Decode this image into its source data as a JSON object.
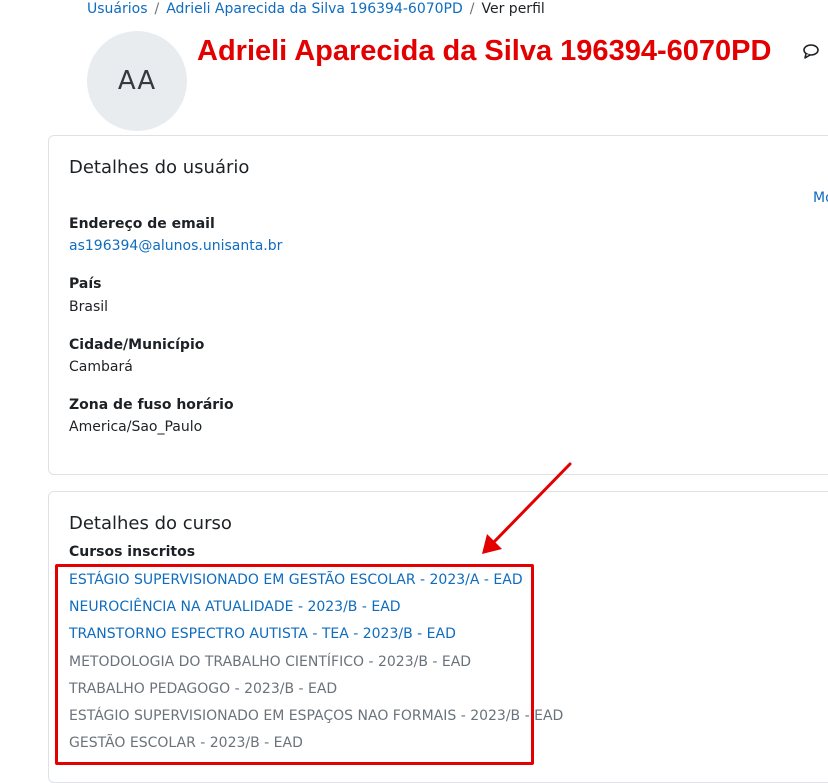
{
  "breadcrumb": {
    "items": [
      {
        "label": "Usuários"
      },
      {
        "label": "Adrieli Aparecida da Silva 196394-6070PD"
      },
      {
        "label": "Ver perfil"
      }
    ],
    "separator": "/"
  },
  "profile": {
    "avatar_initials": "AA",
    "name": "Adrieli Aparecida da Silva 196394-6070PD",
    "message_icon": "speech-bubble-icon"
  },
  "user_details": {
    "title": "Detalhes do usuário",
    "more_link": "Mo",
    "email": {
      "label": "Endereço de email",
      "value": "as196394@alunos.unisanta.br"
    },
    "country": {
      "label": "País",
      "value": "Brasil"
    },
    "city": {
      "label": "Cidade/Município",
      "value": "Cambará"
    },
    "timezone": {
      "label": "Zona de fuso horário",
      "value": "America/Sao_Paulo"
    }
  },
  "course_details": {
    "title": "Detalhes do curso",
    "enrolled_label": "Cursos inscritos",
    "courses": [
      {
        "name": "ESTÁGIO SUPERVISIONADO EM GESTÃO ESCOLAR - 2023/A - EAD",
        "status": "active"
      },
      {
        "name": "NEUROCIÊNCIA NA ATUALIDADE - 2023/B - EAD",
        "status": "active"
      },
      {
        "name": "TRANSTORNO ESPECTRO AUTISTA - TEA - 2023/B - EAD",
        "status": "active"
      },
      {
        "name": "METODOLOGIA DO TRABALHO CIENTÍFICO - 2023/B - EAD",
        "status": "inactive"
      },
      {
        "name": "TRABALHO PEDAGOGO - 2023/B - EAD",
        "status": "inactive"
      },
      {
        "name": "ESTÁGIO SUPERVISIONADO EM ESPAÇOS NAO FORMAIS - 2023/B - EAD",
        "status": "inactive"
      },
      {
        "name": "GESTÃO ESCOLAR - 2023/B - EAD",
        "status": "inactive"
      }
    ]
  },
  "annotation": {
    "color": "#e30000",
    "shapes": [
      "highlight-box",
      "arrow"
    ]
  },
  "colors": {
    "link": "#0f6cbf",
    "muted": "#6a737b",
    "title_red": "#e30000"
  }
}
